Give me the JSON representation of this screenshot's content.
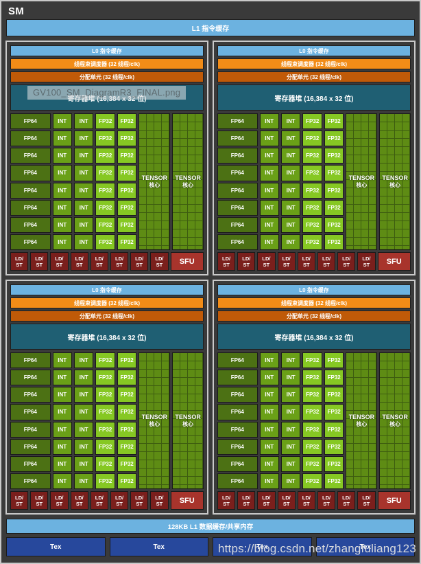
{
  "diagram": {
    "title": "SM",
    "l1_instruction_cache": "L1 指令缓存",
    "l1_data_cache": "128KB L1 数据缓存/共享内存"
  },
  "processing_block": {
    "l0_instruction_cache": "L0 指令缓存",
    "warp_scheduler": "线程束调度器 (32 线程/clk)",
    "dispatch_unit": "分配单元 (32 线程/clk)",
    "register_file": "寄存器堆 (16,384 x 32 位)",
    "fp64_label": "FP64",
    "int_label": "INT",
    "fp32_label": "FP32",
    "tensor_label": "TENSOR",
    "tensor_sub_label": "核心",
    "ldst_line1": "LD/",
    "ldst_line2": "ST",
    "sfu_label": "SFU",
    "fp64_count": 8,
    "int_count": 8,
    "int_columns": 2,
    "fp32_count": 8,
    "fp32_columns": 2,
    "tensor_core_count": 2,
    "ldst_count": 8,
    "sfu_count": 1
  },
  "processing_blocks": [
    {
      "id": "block-top-left"
    },
    {
      "id": "block-top-right"
    },
    {
      "id": "block-bottom-left"
    },
    {
      "id": "block-bottom-right"
    }
  ],
  "tex_units": [
    {
      "label": "Tex"
    },
    {
      "label": "Tex"
    },
    {
      "label": "Tex"
    },
    {
      "label": "Tex"
    }
  ],
  "overlays": {
    "filename_tooltip": "GV100_SM_DiagramR3_FINAL.png",
    "watermark": "https://blog.csdn.net/zhangfuliang123"
  },
  "colors": {
    "background": "#3a3a3a",
    "border": "#c9c9c9",
    "cache_blue": "#6cb2e0",
    "warp_orange": "#f28c17",
    "dispatch_orange": "#c05a08",
    "register_teal": "#1f5f73",
    "fp64_green": "#4c7114",
    "int_green": "#6aa017",
    "fp32_green": "#86c823",
    "tensor_green": "#5e8c14",
    "ldst_red": "#7a1f1c",
    "sfu_red": "#a8342c",
    "tex_blue": "#27489c"
  }
}
